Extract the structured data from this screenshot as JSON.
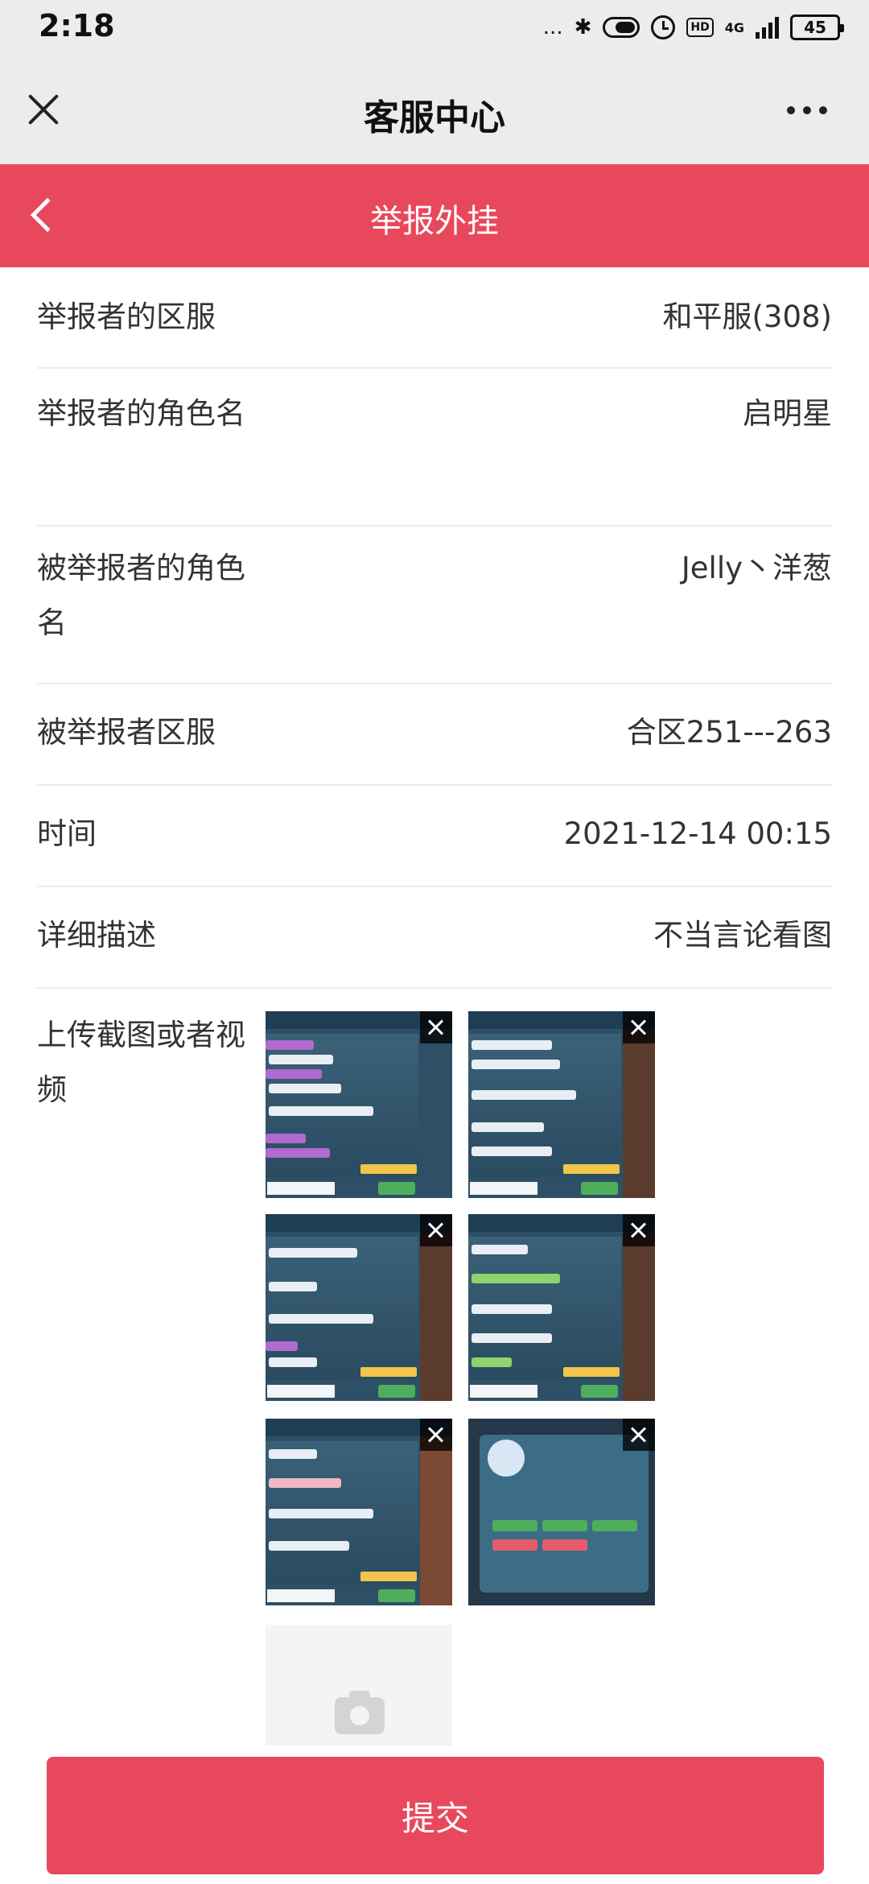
{
  "status_bar": {
    "time": "2:18",
    "dots": "...",
    "hd": "HD",
    "network": "4G",
    "battery": "45"
  },
  "title_bar": {
    "title": "客服中心"
  },
  "header": {
    "title": "举报外挂"
  },
  "form": {
    "rows": [
      {
        "label": "举报者的区服",
        "value": "和平服(308)"
      },
      {
        "label": "举报者的角色名",
        "value": "启明星"
      },
      {
        "label": "被举报者的角色名",
        "value": "Jelly丶洋葱"
      },
      {
        "label": "被举报者区服",
        "value": "合区251---263"
      },
      {
        "label": "时间",
        "value": "2021-12-14 00:15"
      },
      {
        "label": "详细描述",
        "value": "不当言论看图"
      }
    ],
    "upload_label": "上传截图或者视频"
  },
  "submit_label": "提交",
  "colors": {
    "accent": "#e8485c",
    "title_bar_bg": "#ececec"
  }
}
